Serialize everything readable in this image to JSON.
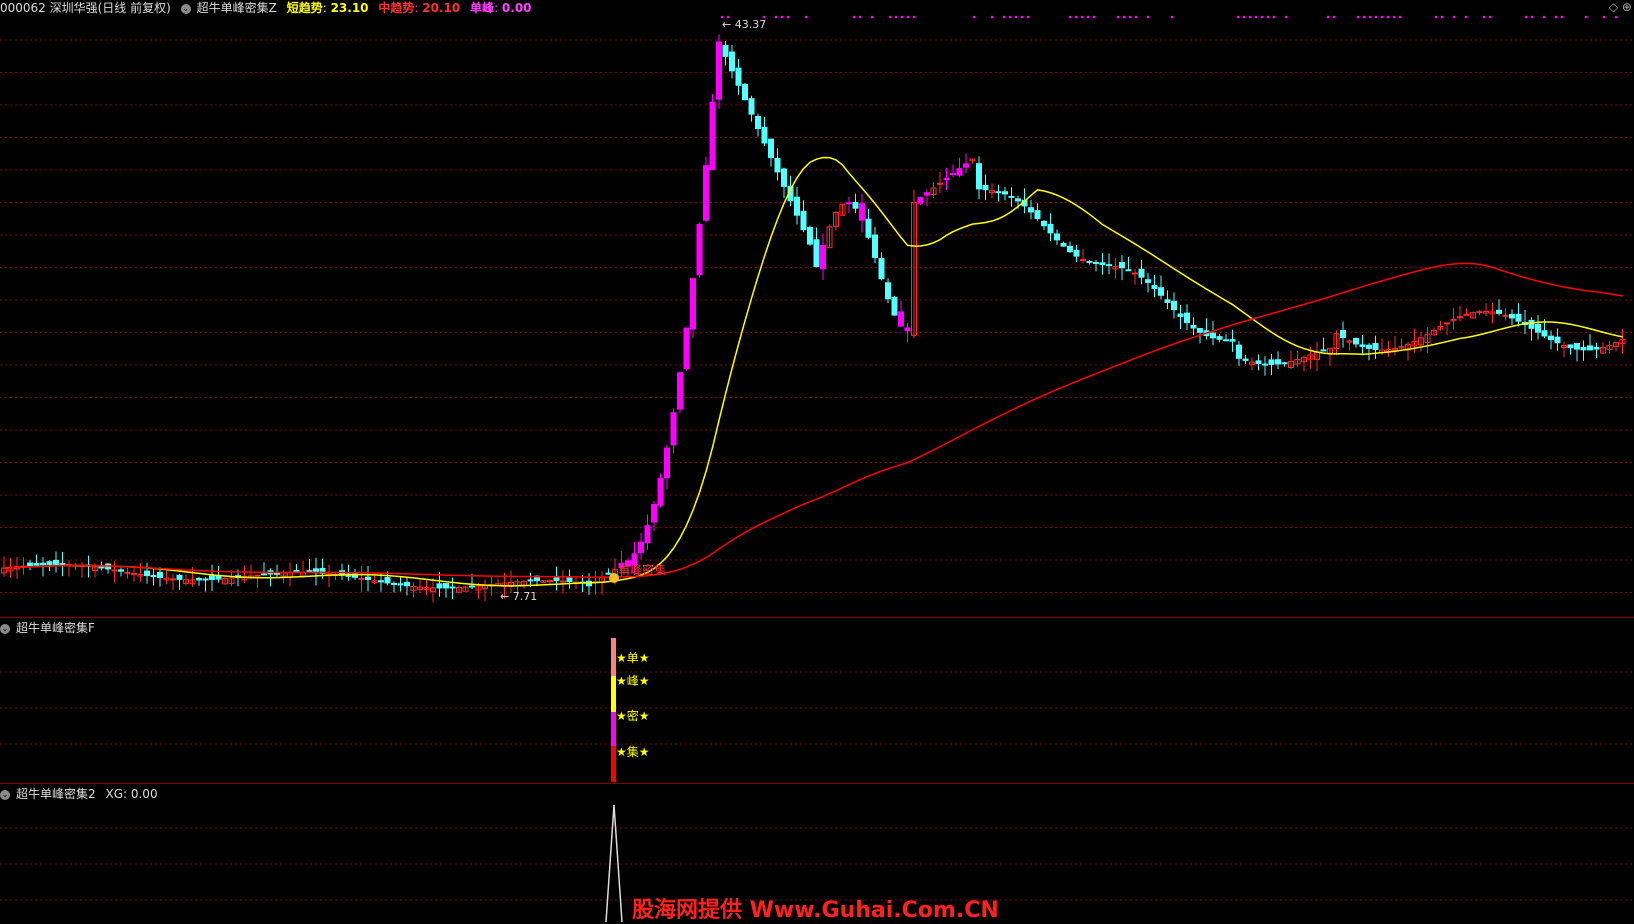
{
  "header": {
    "stock": "000062 深圳华强(日线 前复权)",
    "indicator": "超牛单峰密集Z",
    "short_label": "短趋势",
    "short_value": "23.10",
    "mid_label": "中趋势",
    "mid_value": "20.10",
    "peak_label": "单峰",
    "peak_value": "0.00"
  },
  "panel2": {
    "title": "超牛单峰密集F"
  },
  "panel3": {
    "title": "超牛单峰密集2",
    "xg_label": "XG",
    "xg_value": "0.00"
  },
  "annotations": {
    "high": "43.37",
    "low": "7.71",
    "signal": "单峰密集"
  },
  "stars": [
    "单",
    "峰",
    "密",
    "集"
  ],
  "corner_icon": "diamond-icon",
  "watermark": "股海网提供 Www.Guhai.Com.CN",
  "colors": {
    "up": "#ff2a2a",
    "down": "#54ffff",
    "ma_short": "#ffff00",
    "ma_long": "#ff0000",
    "accent": "#ff00ff",
    "grid": "#8a0000"
  },
  "chart_data": {
    "type": "candlestick",
    "series": [
      {
        "name": "短趋势",
        "color": "#ffff00"
      },
      {
        "name": "中趋势",
        "color": "#ff0000"
      }
    ],
    "price_high": 43.37,
    "price_low": 7.71
  }
}
